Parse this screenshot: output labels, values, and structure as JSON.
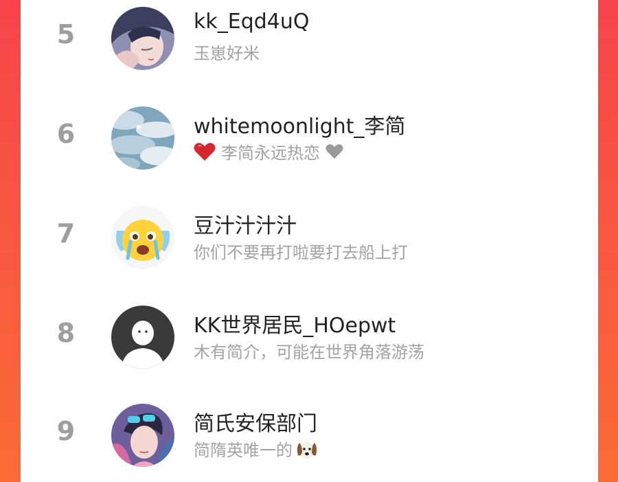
{
  "leaderboard": {
    "rows": [
      {
        "rank": "5",
        "name": "kk_Eqd4uQ",
        "bio": "玉崽好米",
        "avatar_icon": "anime-boy-avatar-icon"
      },
      {
        "rank": "6",
        "name": "whitemoonlight_李简",
        "bio": "李简永远热恋",
        "bio_prefix_icon": "red-heart-icon",
        "bio_suffix_icon": "grey-heart-icon",
        "avatar_icon": "cloudy-sky-avatar-icon"
      },
      {
        "rank": "7",
        "name": "豆汁汁汁汁",
        "bio": "你们不要再打啦要打去船上打",
        "avatar_icon": "crying-emoji-avatar-icon"
      },
      {
        "rank": "8",
        "name": "KK世界居民_HOepwt",
        "bio": "木有简介，可能在世界角落游荡",
        "avatar_icon": "default-user-avatar-icon"
      },
      {
        "rank": "9",
        "name": "简氏安保部门",
        "bio": "简隋英唯一的",
        "bio_suffix_icon": "dog-face-icon",
        "avatar_icon": "anime-man-sunglasses-avatar-icon"
      }
    ]
  },
  "colors": {
    "background_left": "#f8434a",
    "background_right": "#fb6b36",
    "rank_text": "#9e9e9e",
    "name_text": "#222222",
    "bio_text": "#a2a2a2"
  }
}
